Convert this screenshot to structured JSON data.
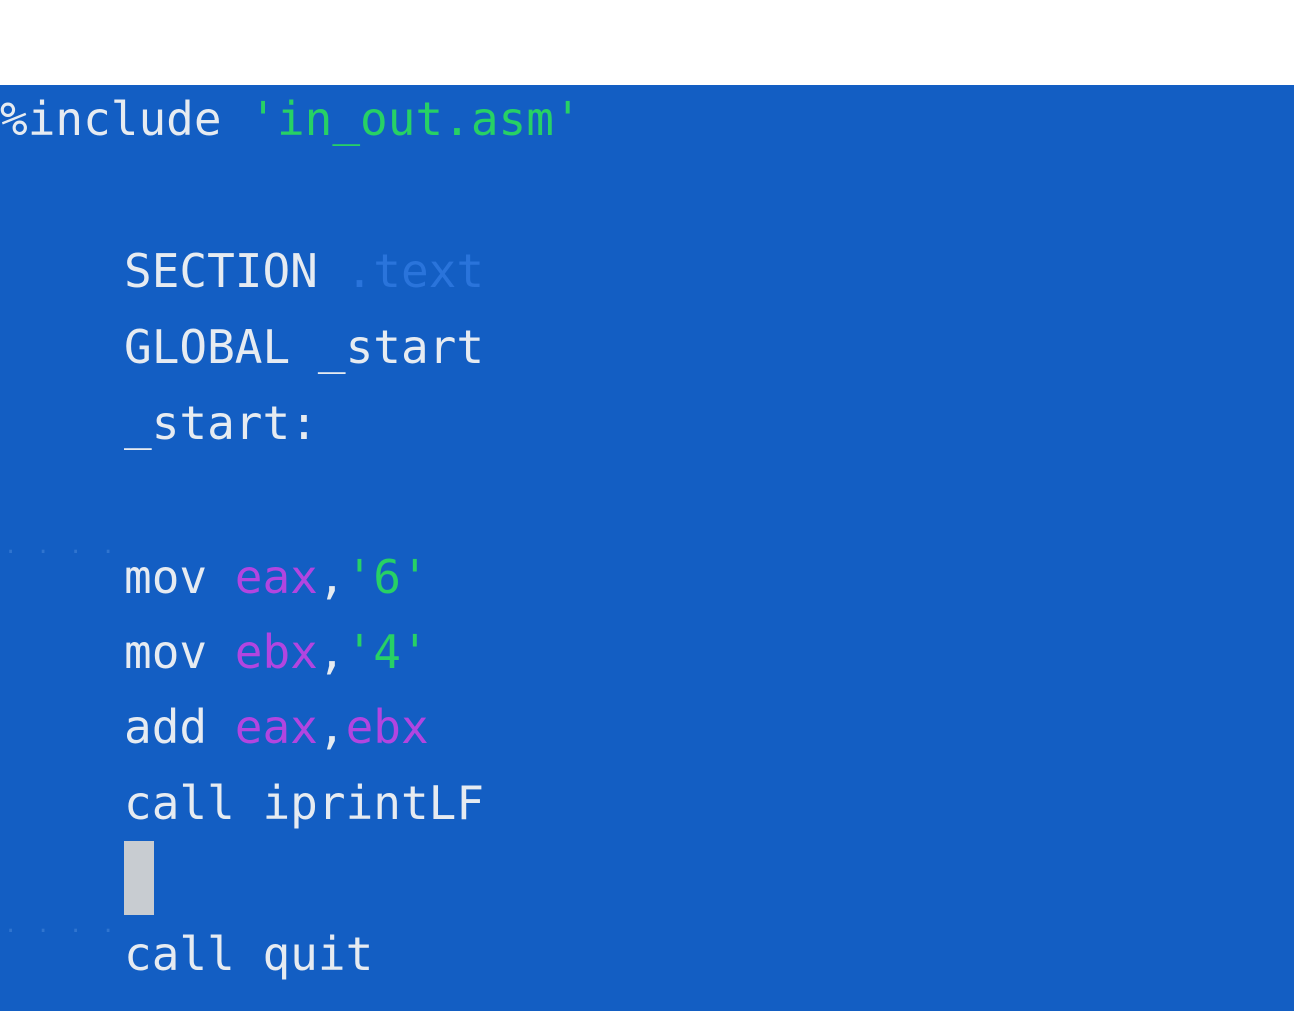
{
  "editor": {
    "colors": {
      "background": "#135ec3",
      "text": "#e6ebf1",
      "string": "#27d165",
      "register": "#b245e0",
      "dimmed": "#2a74db",
      "cursor": "#c8ccd1"
    },
    "line1": {
      "directive": "%include",
      "string": "'in_out.asm'"
    },
    "line2": {
      "keyword": "SECTION",
      "arg": ".text"
    },
    "line3": {
      "keyword": "GLOBAL",
      "arg": "_start"
    },
    "line4": {
      "label": "_start:"
    },
    "line5": {
      "whitespace_marker": "· · · ·"
    },
    "line6": {
      "op": "mov",
      "reg": "eax",
      "comma": ",",
      "imm": "'6'"
    },
    "line7": {
      "op": "mov",
      "reg": "ebx",
      "comma": ",",
      "imm": "'4'"
    },
    "line8": {
      "op": "add",
      "reg1": "eax",
      "comma": ",",
      "reg2": "ebx"
    },
    "line9": {
      "op": "call",
      "arg": "iprintLF"
    },
    "line10": {
      "whitespace_marker": "· · · ·"
    },
    "line11": {
      "op": "call",
      "arg": "quit"
    }
  }
}
